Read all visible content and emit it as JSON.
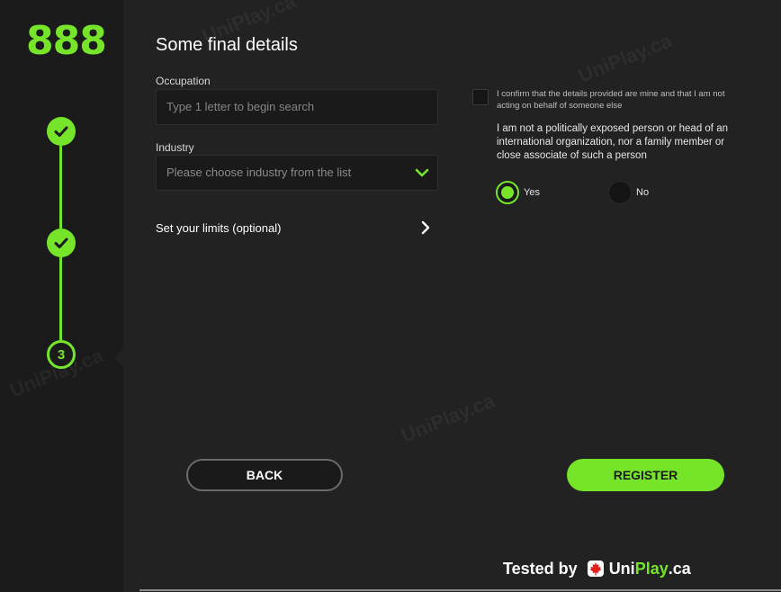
{
  "logo": "888",
  "steps": [
    {
      "state": "done",
      "icon": "check-icon"
    },
    {
      "state": "done",
      "icon": "check-icon"
    },
    {
      "state": "current",
      "number": "3"
    }
  ],
  "page_title": "Some final details",
  "occupation": {
    "label": "Occupation",
    "placeholder": "Type 1 letter to begin search"
  },
  "industry": {
    "label": "Industry",
    "placeholder": "Please choose industry from the list",
    "icon": "chevron-down-icon"
  },
  "limits": {
    "label": "Set your limits (optional)",
    "icon": "chevron-right-icon"
  },
  "confirm": {
    "text": "I confirm that the details provided are mine and that I am not acting on behalf of someone else",
    "checked": false
  },
  "pep": {
    "text": "I am not a politically exposed person or head of an international organization, nor a family member or close associate of such a person",
    "options": [
      {
        "label": "Yes",
        "selected": true
      },
      {
        "label": "No",
        "selected": false
      }
    ]
  },
  "buttons": {
    "back": "BACK",
    "register": "REGISTER"
  },
  "badge": {
    "tested": "Tested by",
    "brand_a": "Uni",
    "brand_b": "Play",
    "brand_c": ".ca",
    "icon": "maple-leaf-icon"
  },
  "watermark": "UniPlay.ca",
  "colors": {
    "accent": "#76e52a",
    "background": "#222222",
    "sidebar": "#1b1b1b",
    "field": "#1a1a1a"
  }
}
